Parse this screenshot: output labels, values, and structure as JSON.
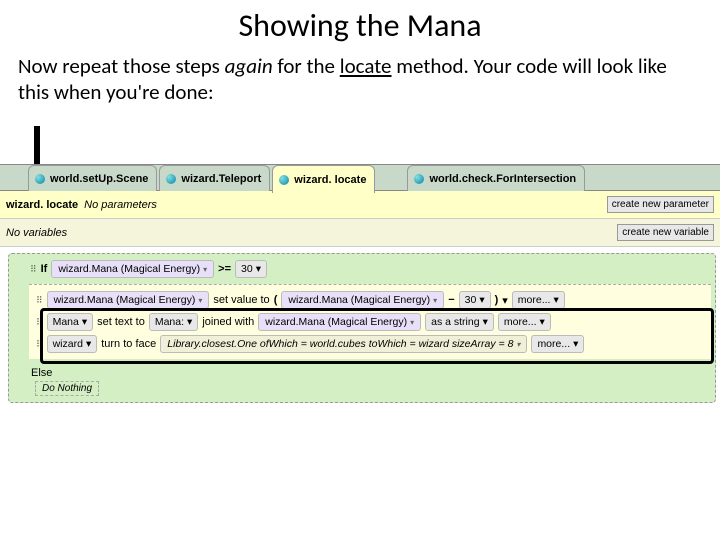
{
  "heading": "Showing the Mana",
  "desc": {
    "p1a": "Now repeat those steps ",
    "p1_again": "again",
    "p1b": " for the ",
    "p1_locate": "locate",
    "p1c": " method. Your code will look like this when you're done:"
  },
  "tabs": {
    "t1": "world.setUp.Scene",
    "t2": "wizard.Teleport",
    "t3": "wizard. locate",
    "t4": "world.check.ForIntersection"
  },
  "params": {
    "title": "wizard. locate",
    "noparams": "No parameters",
    "btn": "create new parameter"
  },
  "vars": {
    "novars": "No variables",
    "btn": "create new variable"
  },
  "code": {
    "if_label": "If",
    "mana_param": "wizard.Mana (Magical Energy)",
    "gte": ">=",
    "thirty": "30",
    "setvalue": "set  value  to",
    "minus": "−",
    "more": "more...",
    "mana_lbl": "Mana",
    "settext": "set  text  to",
    "mana_colon": "Mana:",
    "joined": "joined with",
    "asstring": "as a string",
    "wizard": "wizard",
    "turnface": "turn to face",
    "lib": "Library.closest.One ofWhich = world.cubes   toWhich = wizard   sizeArray = 8",
    "else": "Else",
    "donothing": "Do Nothing"
  }
}
